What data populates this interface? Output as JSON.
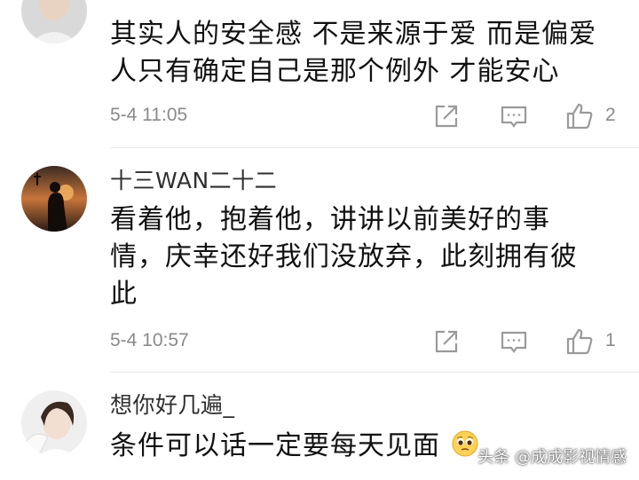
{
  "comments": [
    {
      "username": "",
      "content_lines": [
        "其实人的安全感 不是来源于爱 而是偏爱",
        "人只有确定自己是那个例外 才能安心"
      ],
      "timestamp": "5-4 11:05",
      "likes": "2"
    },
    {
      "username": "十三WAN二十二",
      "content_lines": [
        "看着他，抱着他，讲讲以前美好的事",
        "情，庆幸还好我们没放弃，此刻拥有彼",
        "此"
      ],
      "timestamp": "5-4 10:57",
      "likes": "1"
    },
    {
      "username": "想你好几遍_",
      "content_lines": [
        "条件可以话一定要每天见面"
      ],
      "emoji": "pleading-face-emoji"
    }
  ],
  "watermark": "头条 @成成影视情感",
  "icons": [
    "share-icon",
    "comment-icon",
    "thumbs-up-icon",
    "pleading-face-emoji"
  ],
  "colors": {
    "text_primary": "#111111",
    "text_secondary": "#8a8a8a",
    "icon_gray": "#9a9a9a",
    "divider": "#e9e9e9"
  }
}
